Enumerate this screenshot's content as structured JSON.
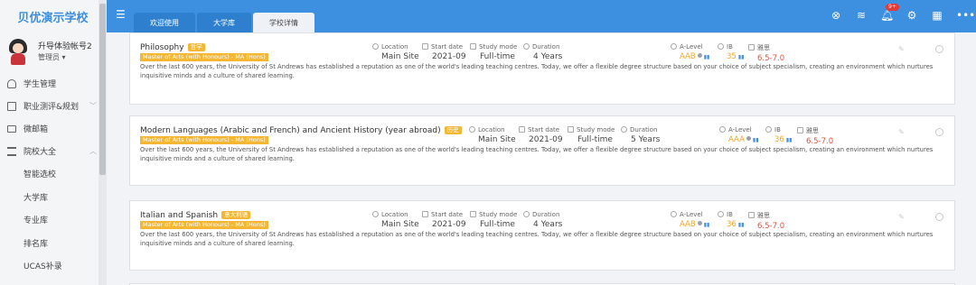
{
  "sidebar": {
    "school_name": "贝优演示学校",
    "user_name": "升导体验帐号2",
    "user_role": "管理员 ▾",
    "items": [
      {
        "label": "学生管理",
        "icon": "students-icon"
      },
      {
        "label": "职业测评&规划",
        "icon": "document-icon"
      },
      {
        "label": "微邮箱",
        "icon": "mail-icon"
      },
      {
        "label": "院校大全",
        "icon": "university-icon"
      }
    ],
    "subitems": [
      "智能选校",
      "大学库",
      "专业库",
      "排名库",
      "UCAS补录"
    ]
  },
  "topbar": {
    "tabs": [
      "欢迎使用",
      "大学库",
      "学校详情"
    ],
    "notification_count": "9+"
  },
  "labels": {
    "location": "Location",
    "start_date": "Start date",
    "study_mode": "Study mode",
    "duration": "Duration",
    "alevel": "A-Level",
    "ib": "IB",
    "ielts": "雅思"
  },
  "courses": [
    {
      "title": "Philosophy",
      "tag": "哲学",
      "degree": "Master of Arts (with Honours) - MA (Hons)",
      "location": "Main Site",
      "start_date": "2021-09",
      "study_mode": "Full-time",
      "duration": "4 Years",
      "alevel": "AAB",
      "ib": "35",
      "ielts": "6.5-7.0",
      "description": "Over the last 600 years, the University of St Andrews has established a reputation as one of the world's leading teaching centres. Today, we offer a flexible degree structure based on your choice of subject specialism, creating an environment which nurtures inquisitive minds and a culture of shared learning."
    },
    {
      "title": "Modern Languages (Arabic and French) and Ancient History (year abroad)",
      "tag": "历史",
      "degree": "Master of Arts (with Honours) - MA (Hons)",
      "location": "Main Site",
      "start_date": "2021-09",
      "study_mode": "Full-time",
      "duration": "5 Years",
      "alevel": "AAA",
      "ib": "36",
      "ielts": "6.5-7.0",
      "description": "Over the last 600 years, the University of St Andrews has established a reputation as one of the world's leading teaching centres. Today, we offer a flexible degree structure based on your choice of subject specialism, creating an environment which nurtures inquisitive minds and a culture of shared learning."
    },
    {
      "title": "Italian and Spanish",
      "tag": "意大利语",
      "degree": "Master of Arts (with Honours) - MA (Hons)",
      "location": "Main Site",
      "start_date": "2021-09",
      "study_mode": "Full-time",
      "duration": "4 Years",
      "alevel": "AAB",
      "ib": "36",
      "ielts": "6.5-7.0",
      "description": "Over the last 600 years, the University of St Andrews has established a reputation as one of the world's leading teaching centres. Today, we offer a flexible degree structure based on your choice of subject specialism, creating an environment which nurtures inquisitive minds and a culture of shared learning."
    }
  ]
}
